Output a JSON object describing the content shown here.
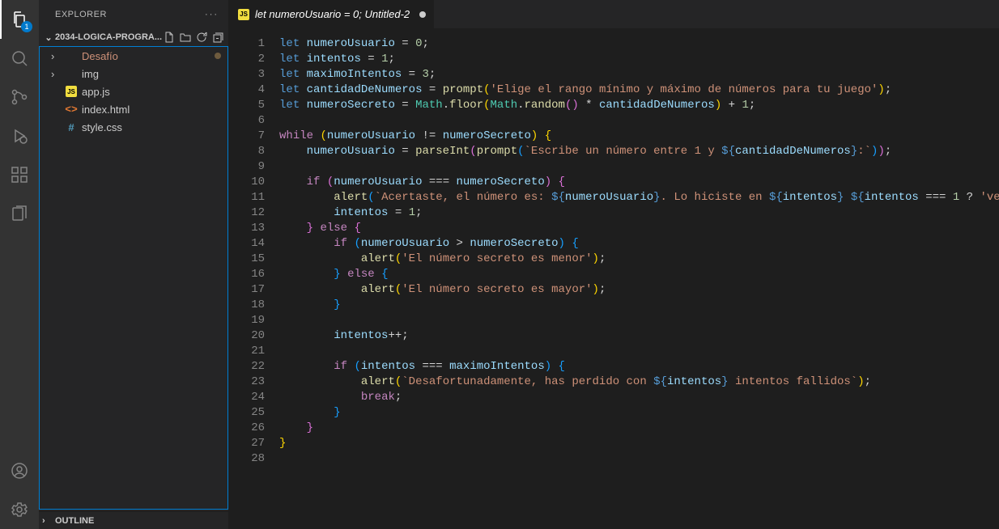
{
  "activitybar": {
    "explorer_badge": "1"
  },
  "sidebar": {
    "title": "EXPLORER",
    "ellipsis": "···",
    "folder_name": "2034-LOGICA-PROGRA...",
    "tree": [
      {
        "type": "folder",
        "label": "Desafío",
        "modified": true,
        "color": "orange"
      },
      {
        "type": "folder",
        "label": "img"
      },
      {
        "type": "file",
        "label": "app.js",
        "icon": "js"
      },
      {
        "type": "file",
        "label": "index.html",
        "icon": "html"
      },
      {
        "type": "file",
        "label": "style.css",
        "icon": "css"
      }
    ],
    "outline": "OUTLINE"
  },
  "tab": {
    "icon": "js",
    "label": "let numeroUsuario = 0; Untitled-2",
    "modified": true
  },
  "code": {
    "lines": [
      [
        [
          "kw",
          "let "
        ],
        [
          "var",
          "numeroUsuario"
        ],
        [
          "op",
          " = "
        ],
        [
          "num",
          "0"
        ],
        [
          "pun",
          ";"
        ]
      ],
      [
        [
          "kw",
          "let "
        ],
        [
          "var",
          "intentos"
        ],
        [
          "op",
          " = "
        ],
        [
          "num",
          "1"
        ],
        [
          "pun",
          ";"
        ]
      ],
      [
        [
          "kw",
          "let "
        ],
        [
          "var",
          "maximoIntentos"
        ],
        [
          "op",
          " = "
        ],
        [
          "num",
          "3"
        ],
        [
          "pun",
          ";"
        ]
      ],
      [
        [
          "kw",
          "let "
        ],
        [
          "var",
          "cantidadDeNumeros"
        ],
        [
          "op",
          " = "
        ],
        [
          "fn",
          "prompt"
        ],
        [
          "brace",
          "("
        ],
        [
          "str",
          "'Elige el rango mínimo y máximo de números para tu juego'"
        ],
        [
          "brace",
          ")"
        ],
        [
          "pun",
          ";"
        ]
      ],
      [
        [
          "kw",
          "let "
        ],
        [
          "var",
          "numeroSecreto"
        ],
        [
          "op",
          " = "
        ],
        [
          "cls",
          "Math"
        ],
        [
          "pun",
          "."
        ],
        [
          "fn",
          "floor"
        ],
        [
          "brace",
          "("
        ],
        [
          "cls",
          "Math"
        ],
        [
          "pun",
          "."
        ],
        [
          "fn",
          "random"
        ],
        [
          "brace2",
          "()"
        ],
        [
          "op",
          " * "
        ],
        [
          "var",
          "cantidadDeNumeros"
        ],
        [
          "brace",
          ")"
        ],
        [
          "op",
          " + "
        ],
        [
          "num",
          "1"
        ],
        [
          "pun",
          ";"
        ]
      ],
      [],
      [
        [
          "kwc",
          "while"
        ],
        [
          "op",
          " "
        ],
        [
          "brace",
          "("
        ],
        [
          "var",
          "numeroUsuario"
        ],
        [
          "op",
          " != "
        ],
        [
          "var",
          "numeroSecreto"
        ],
        [
          "brace",
          ")"
        ],
        [
          "op",
          " "
        ],
        [
          "brace",
          "{"
        ]
      ],
      [
        [
          "op",
          "    "
        ],
        [
          "var",
          "numeroUsuario"
        ],
        [
          "op",
          " = "
        ],
        [
          "fn",
          "parseInt"
        ],
        [
          "brace2",
          "("
        ],
        [
          "fn",
          "prompt"
        ],
        [
          "brace3",
          "("
        ],
        [
          "str",
          "`Escribe un número entre 1 y "
        ],
        [
          "tmpl",
          "${"
        ],
        [
          "var",
          "cantidadDeNumeros"
        ],
        [
          "tmpl",
          "}"
        ],
        [
          "str",
          ":`"
        ],
        [
          "brace3",
          ")"
        ],
        [
          "brace2",
          ")"
        ],
        [
          "pun",
          ";"
        ]
      ],
      [],
      [
        [
          "op",
          "    "
        ],
        [
          "kwc",
          "if"
        ],
        [
          "op",
          " "
        ],
        [
          "brace2",
          "("
        ],
        [
          "var",
          "numeroUsuario"
        ],
        [
          "op",
          " === "
        ],
        [
          "var",
          "numeroSecreto"
        ],
        [
          "brace2",
          ")"
        ],
        [
          "op",
          " "
        ],
        [
          "brace2",
          "{"
        ]
      ],
      [
        [
          "op",
          "        "
        ],
        [
          "fn",
          "alert"
        ],
        [
          "brace3",
          "("
        ],
        [
          "str",
          "`Acertaste, el número es: "
        ],
        [
          "tmpl",
          "${"
        ],
        [
          "var",
          "numeroUsuario"
        ],
        [
          "tmpl",
          "}"
        ],
        [
          "str",
          ". Lo hiciste en "
        ],
        [
          "tmpl",
          "${"
        ],
        [
          "var",
          "intentos"
        ],
        [
          "tmpl",
          "}"
        ],
        [
          "str",
          " "
        ],
        [
          "tmpl",
          "${"
        ],
        [
          "var",
          "intentos"
        ],
        [
          "op",
          " === "
        ],
        [
          "num",
          "1"
        ],
        [
          "op",
          " ? "
        ],
        [
          "str",
          "'vez'"
        ],
        [
          "op",
          " : "
        ],
        [
          "str",
          "'"
        ]
      ],
      [
        [
          "op",
          "        "
        ],
        [
          "var",
          "intentos"
        ],
        [
          "op",
          " = "
        ],
        [
          "num",
          "1"
        ],
        [
          "pun",
          ";"
        ]
      ],
      [
        [
          "op",
          "    "
        ],
        [
          "brace2",
          "}"
        ],
        [
          "op",
          " "
        ],
        [
          "kwc",
          "else"
        ],
        [
          "op",
          " "
        ],
        [
          "brace2",
          "{"
        ]
      ],
      [
        [
          "op",
          "        "
        ],
        [
          "kwc",
          "if"
        ],
        [
          "op",
          " "
        ],
        [
          "brace3",
          "("
        ],
        [
          "var",
          "numeroUsuario"
        ],
        [
          "op",
          " > "
        ],
        [
          "var",
          "numeroSecreto"
        ],
        [
          "brace3",
          ")"
        ],
        [
          "op",
          " "
        ],
        [
          "brace3",
          "{"
        ]
      ],
      [
        [
          "op",
          "            "
        ],
        [
          "fn",
          "alert"
        ],
        [
          "brace",
          "("
        ],
        [
          "str",
          "'El número secreto es menor'"
        ],
        [
          "brace",
          ")"
        ],
        [
          "pun",
          ";"
        ]
      ],
      [
        [
          "op",
          "        "
        ],
        [
          "brace3",
          "}"
        ],
        [
          "op",
          " "
        ],
        [
          "kwc",
          "else"
        ],
        [
          "op",
          " "
        ],
        [
          "brace3",
          "{"
        ]
      ],
      [
        [
          "op",
          "            "
        ],
        [
          "fn",
          "alert"
        ],
        [
          "brace",
          "("
        ],
        [
          "str",
          "'El número secreto es mayor'"
        ],
        [
          "brace",
          ")"
        ],
        [
          "pun",
          ";"
        ]
      ],
      [
        [
          "op",
          "        "
        ],
        [
          "brace3",
          "}"
        ]
      ],
      [],
      [
        [
          "op",
          "        "
        ],
        [
          "var",
          "intentos"
        ],
        [
          "op",
          "++"
        ],
        [
          "pun",
          ";"
        ]
      ],
      [],
      [
        [
          "op",
          "        "
        ],
        [
          "kwc",
          "if"
        ],
        [
          "op",
          " "
        ],
        [
          "brace3",
          "("
        ],
        [
          "var",
          "intentos"
        ],
        [
          "op",
          " === "
        ],
        [
          "var",
          "maximoIntentos"
        ],
        [
          "brace3",
          ")"
        ],
        [
          "op",
          " "
        ],
        [
          "brace3",
          "{"
        ]
      ],
      [
        [
          "op",
          "            "
        ],
        [
          "fn",
          "alert"
        ],
        [
          "brace",
          "("
        ],
        [
          "str",
          "`Desafortunadamente, has perdido con "
        ],
        [
          "tmpl",
          "${"
        ],
        [
          "var",
          "intentos"
        ],
        [
          "tmpl",
          "}"
        ],
        [
          "str",
          " intentos fallidos`"
        ],
        [
          "brace",
          ")"
        ],
        [
          "pun",
          ";"
        ]
      ],
      [
        [
          "op",
          "            "
        ],
        [
          "kwc",
          "break"
        ],
        [
          "pun",
          ";"
        ]
      ],
      [
        [
          "op",
          "        "
        ],
        [
          "brace3",
          "}"
        ]
      ],
      [
        [
          "op",
          "    "
        ],
        [
          "brace2",
          "}"
        ]
      ],
      [
        [
          "brace",
          "}"
        ]
      ],
      []
    ]
  }
}
